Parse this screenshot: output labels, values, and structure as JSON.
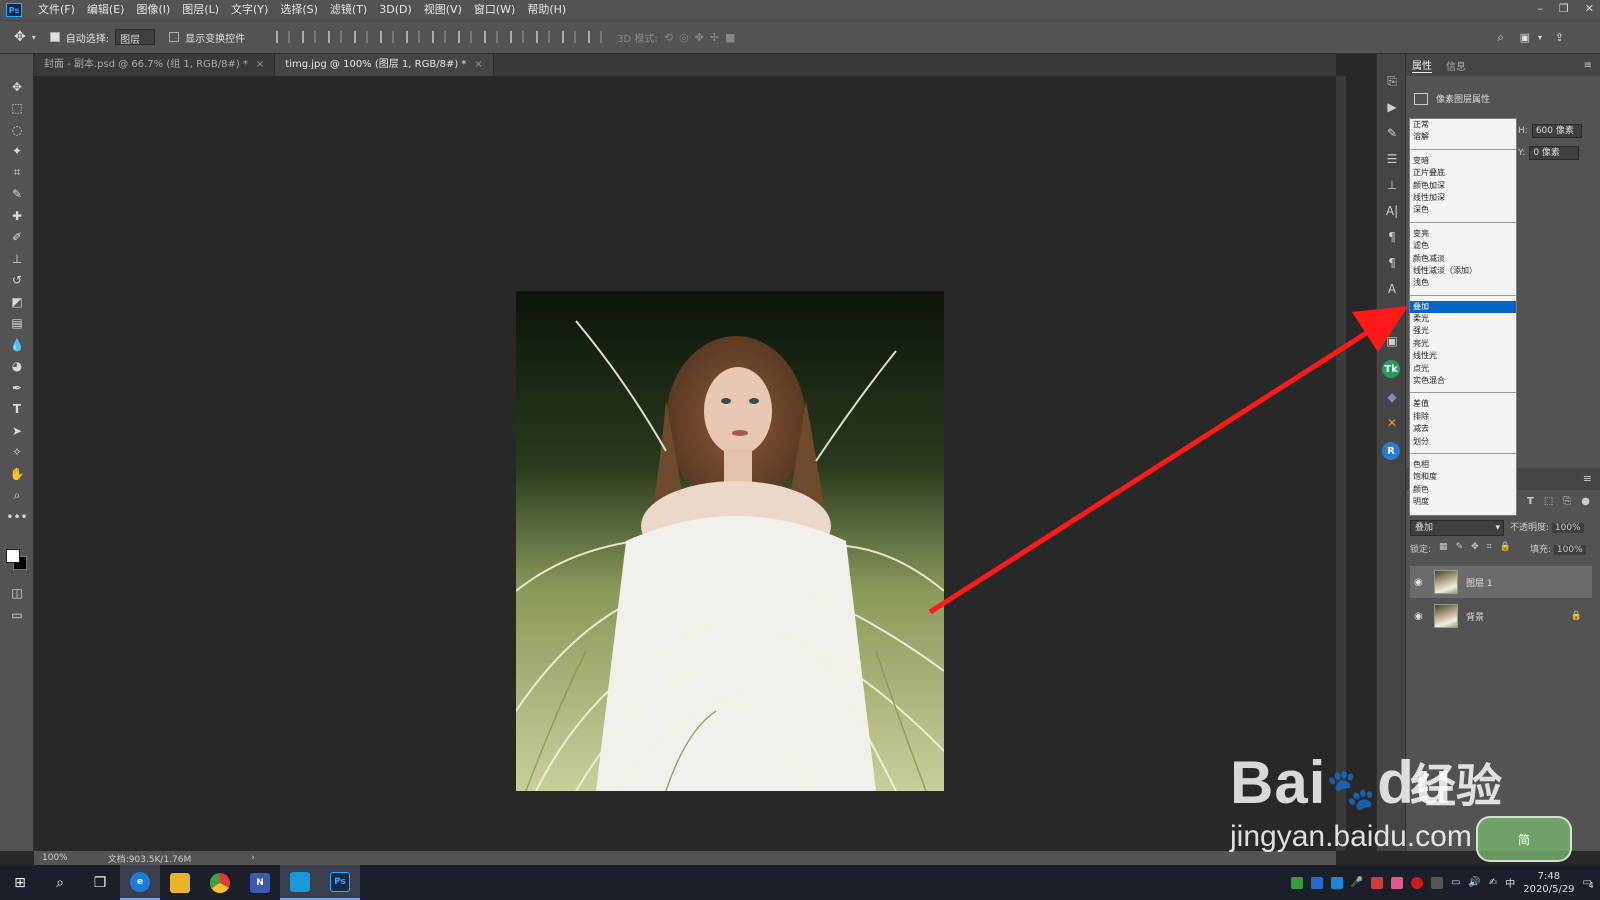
{
  "menubar": {
    "logo": "Ps",
    "items": [
      "文件(F)",
      "编辑(E)",
      "图像(I)",
      "图层(L)",
      "文字(Y)",
      "选择(S)",
      "滤镜(T)",
      "3D(D)",
      "视图(V)",
      "窗口(W)",
      "帮助(H)"
    ],
    "window_controls": [
      "–",
      "❐",
      "✕"
    ]
  },
  "options": {
    "auto_select_label": "自动选择:",
    "auto_select_value": "图层",
    "show_transform_label": "显示变换控件",
    "mode_3d_label": "3D 模式:"
  },
  "tabs": [
    {
      "label": "封面 - 副本.psd @ 66.7% (组 1, RGB/8#) *",
      "close": "×"
    },
    {
      "label": "timg.jpg @ 100% (图层 1, RGB/8#) *",
      "close": "×"
    }
  ],
  "status": {
    "zoom": "100%",
    "doc": "文档:903.5K/1.76M",
    "arrow": "›"
  },
  "properties": {
    "tab_properties": "属性",
    "tab_info": "信息",
    "title": "像素图层属性",
    "h_label": "H:",
    "h_value": "600 像素",
    "y_label": "Y:",
    "y_value": "0 像素"
  },
  "blend_menu": {
    "groups": [
      [
        "正常",
        "溶解"
      ],
      [
        "变暗",
        "正片叠底",
        "颜色加深",
        "线性加深",
        "深色"
      ],
      [
        "变亮",
        "滤色",
        "颜色减淡",
        "线性减淡（添加）",
        "浅色"
      ],
      [
        "叠加",
        "柔光",
        "强光",
        "亮光",
        "线性光",
        "点光",
        "实色混合"
      ],
      [
        "差值",
        "排除",
        "减去",
        "划分"
      ],
      [
        "色相",
        "饱和度",
        "颜色",
        "明度"
      ]
    ],
    "selected": "叠加"
  },
  "layers": {
    "blend_value": "叠加",
    "opacity_label": "不透明度:",
    "opacity_value": "100%",
    "lock_label": "锁定:",
    "fill_label": "填充:",
    "fill_value": "100%",
    "items": [
      {
        "name": "图层 1",
        "selected": true
      },
      {
        "name": "背景",
        "selected": false
      }
    ]
  },
  "taskbar": {
    "clock_time": "7:48",
    "clock_date": "2020/5/29",
    "ime": "中",
    "notify_count": "4"
  },
  "watermark": {
    "brand": "Bai",
    "brand2": "du",
    "cn": "经验",
    "url": "jingyan.baidu.com",
    "badge": "简"
  },
  "colors": {
    "annotation_arrow": "#ff1a1a",
    "selection_blue": "#0a64c8"
  }
}
